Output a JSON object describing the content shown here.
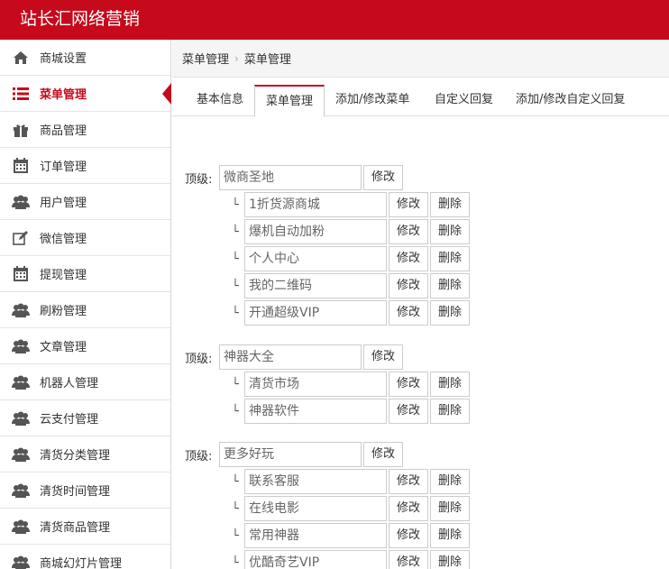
{
  "header": {
    "title": "站长汇网络营销"
  },
  "sidebar": {
    "items": [
      {
        "label": "商城设置",
        "icon": "home-icon"
      },
      {
        "label": "菜单管理",
        "icon": "list-icon",
        "active": true
      },
      {
        "label": "商品管理",
        "icon": "gift-icon"
      },
      {
        "label": "订单管理",
        "icon": "calendar-icon"
      },
      {
        "label": "用户管理",
        "icon": "users-icon"
      },
      {
        "label": "微信管理",
        "icon": "edit-icon"
      },
      {
        "label": "提现管理",
        "icon": "calendar-icon"
      },
      {
        "label": "刷粉管理",
        "icon": "users-icon"
      },
      {
        "label": "文章管理",
        "icon": "users-icon"
      },
      {
        "label": "机器人管理",
        "icon": "users-icon"
      },
      {
        "label": "云支付管理",
        "icon": "users-icon"
      },
      {
        "label": "清货分类管理",
        "icon": "users-icon"
      },
      {
        "label": "清货时间管理",
        "icon": "users-icon"
      },
      {
        "label": "清货商品管理",
        "icon": "users-icon"
      },
      {
        "label": "商城幻灯片管理",
        "icon": "users-icon"
      }
    ]
  },
  "breadcrumb": {
    "first": "菜单管理",
    "separator": "›",
    "second": "菜单管理"
  },
  "tabs": [
    {
      "label": "基本信息"
    },
    {
      "label": "菜单管理",
      "active": true
    },
    {
      "label": "添加/修改菜单"
    },
    {
      "label": "自定义回复"
    },
    {
      "label": "添加/修改自定义回复"
    }
  ],
  "menu": {
    "top_label": "顶级:",
    "tree_mark": "└",
    "edit_label": "修改",
    "delete_label": "删除",
    "groups": [
      {
        "name": "微商圣地",
        "children": [
          "1折货源商城",
          "爆机自动加粉",
          "个人中心",
          "我的二维码",
          "开通超级VIP"
        ]
      },
      {
        "name": "神器大全",
        "children": [
          "清货市场",
          "神器软件"
        ]
      },
      {
        "name": "更多好玩",
        "children": [
          "联系客服",
          "在线电影",
          "常用神器",
          "优酷奇艺VIP"
        ]
      }
    ]
  },
  "colors": {
    "brand": "#c6091b"
  }
}
